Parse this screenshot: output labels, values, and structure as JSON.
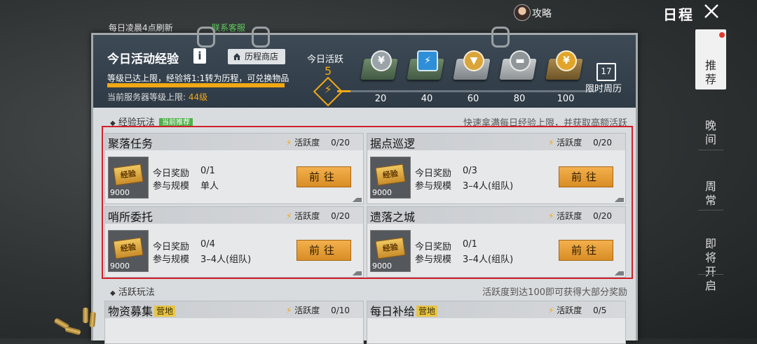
{
  "top": {
    "notice": "每日凌晨4点刷新",
    "customer_service": "联系客服",
    "strategy": "攻略",
    "title": "日程"
  },
  "side_tabs": [
    {
      "label": "推\n荐",
      "active": true,
      "badge": true
    },
    {
      "label": "晚\n间",
      "active": false
    },
    {
      "label": "周\n常",
      "active": false
    },
    {
      "label": "即\n将\n开\n启",
      "active": false
    }
  ],
  "header": {
    "title": "今日活动经验",
    "info": "i",
    "history_shop": "历程商店",
    "desc": "等级已达上限，经验将1:1转为历程，可兑换物品",
    "exp_fill": 1.0,
    "server_level_label": "当前服务器等级上限:",
    "server_level_value": "44级"
  },
  "activity": {
    "label": "今日活跃",
    "value": "5",
    "bolt": "⚡",
    "progress": 0.05,
    "milestones": [
      "20",
      "40",
      "60",
      "80",
      "100"
    ],
    "weekly_day": "17",
    "weekly_label": "限时周历"
  },
  "section_exp": {
    "title": "经验玩法",
    "tag": "当前推荐",
    "note": "快速拿满每日经验上限，并获取高额活跃"
  },
  "section_active": {
    "title": "活跃玩法",
    "note": "活跃度到达100即可获得大部分奖励"
  },
  "labels": {
    "active_degree": "活跃度",
    "reward": "今日奖励",
    "scale": "参与规模",
    "go": "前往",
    "ticket_text": "经验",
    "ticket_value": "9000"
  },
  "cards": [
    {
      "name": "聚落任务",
      "active": "0/20",
      "reward": "0/1",
      "scale": "单人"
    },
    {
      "name": "据点巡逻",
      "active": "0/20",
      "reward": "0/3",
      "scale": "3–4人(组队)"
    },
    {
      "name": "哨所委托",
      "active": "0/20",
      "reward": "0/4",
      "scale": "3–4人(组队)"
    },
    {
      "name": "遗落之城",
      "active": "0/20",
      "reward": "0/1",
      "scale": "3–4人(组队)"
    }
  ],
  "bottom_cards": [
    {
      "name": "物资募集",
      "tag": "营地",
      "active": "0/10"
    },
    {
      "name": "每日补给",
      "tag": "营地",
      "active": "0/5"
    }
  ],
  "colors": {
    "accent": "#f2a815",
    "highlight": "#d0202a",
    "recommend": "#4fb04b",
    "camp": "#e8c544"
  }
}
